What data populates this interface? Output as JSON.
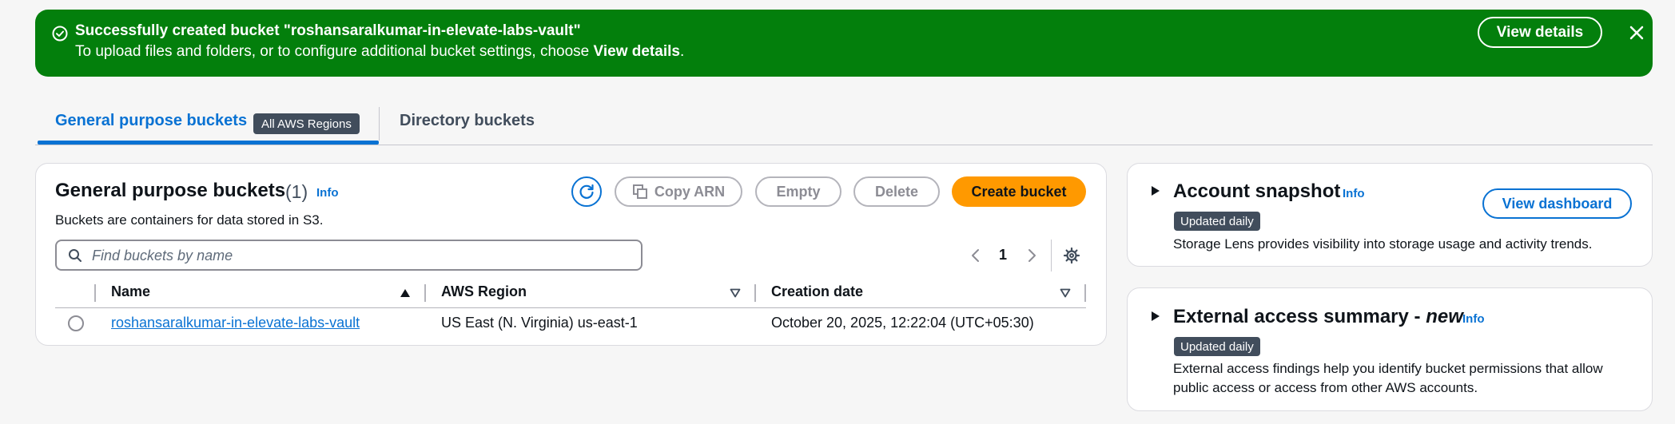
{
  "flash": {
    "title": "Successfully created bucket \"roshansaralkumar-in-elevate-labs-vault\"",
    "message_prefix": "To upload files and folders, or to configure additional bucket settings, choose ",
    "message_bold": "View details",
    "message_suffix": ".",
    "view_details_label": "View details",
    "color": "#037f0c"
  },
  "tabs": {
    "general": "General purpose buckets",
    "region_badge": "All AWS Regions",
    "directory": "Directory buckets",
    "accent": "#0972d3"
  },
  "panel": {
    "title": "General purpose buckets",
    "count": "(1)",
    "info": "Info",
    "description": "Buckets are containers for data stored in S3.",
    "actions": {
      "copy_arn": "Copy ARN",
      "empty": "Empty",
      "delete": "Delete",
      "create": "Create bucket"
    },
    "search_placeholder": "Find buckets by name",
    "page": "1",
    "columns": [
      "Name",
      "AWS Region",
      "Creation date"
    ],
    "rows": [
      {
        "name": "roshansaralkumar-in-elevate-labs-vault",
        "region": "US East (N. Virginia) us-east-1",
        "created": "October 20, 2025, 12:22:04 (UTC+05:30)"
      }
    ]
  },
  "snapshot": {
    "title": "Account snapshot",
    "info": "Info",
    "badge": "Updated daily",
    "description": "Storage Lens provides visibility into storage usage and activity trends.",
    "button": "View dashboard"
  },
  "external": {
    "title": "External access summary - ",
    "title_new": "new",
    "info": "Info",
    "badge": "Updated daily",
    "description_line1": "External access findings help you identify bucket permissions that allow",
    "description_line2": "public access or access from other AWS accounts."
  },
  "icons": [
    "check-circle-icon",
    "close-icon",
    "refresh-icon",
    "copy-icon",
    "search-icon",
    "chevron-left-icon",
    "chevron-right-icon",
    "gear-icon",
    "sort-ascending-icon",
    "sort-down-icon",
    "caret-right-icon"
  ],
  "colors": {
    "primary_button": "#ff9900",
    "link": "#0972d3",
    "badge": "#414d5c"
  }
}
